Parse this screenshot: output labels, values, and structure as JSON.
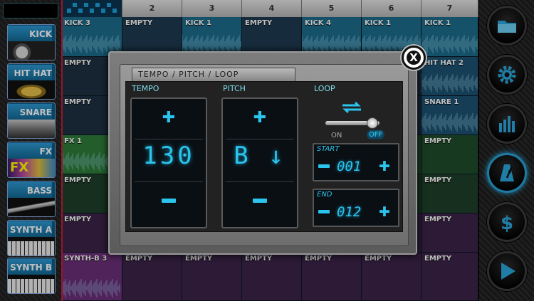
{
  "instruments": [
    "KICK",
    "HIT HAT",
    "SNARE",
    "FX",
    "BASS",
    "SYNTH A",
    "SYNTH B"
  ],
  "columns": [
    "",
    "2",
    "3",
    "4",
    "5",
    "6",
    "7"
  ],
  "rows": [
    [
      "KICK 3",
      "EMPTY",
      "KICK 1",
      "EMPTY",
      "KICK 4",
      "KICK 1",
      "KICK 1"
    ],
    [
      "EMPTY",
      "",
      "",
      "",
      "",
      "",
      "HIT HAT 2"
    ],
    [
      "EMPTY",
      "",
      "",
      "",
      "",
      "",
      "SNARE 1"
    ],
    [
      "FX 1",
      "",
      "",
      "",
      "",
      "",
      "EMPTY"
    ],
    [
      "EMPTY",
      "",
      "",
      "",
      "",
      "",
      "EMPTY"
    ],
    [
      "EMPTY",
      "",
      "",
      "",
      "",
      "",
      "EMPTY"
    ],
    [
      "SYNTH-B 3",
      "EMPTY",
      "EMPTY",
      "EMPTY",
      "EMPTY",
      "EMPTY",
      "EMPTY"
    ]
  ],
  "modal": {
    "title": "TEMPO / PITCH / LOOP",
    "close_label": "X",
    "tempo": {
      "label": "TEMPO",
      "value": "130"
    },
    "pitch": {
      "label": "PITCH",
      "value": "B ↓"
    },
    "loop": {
      "label": "LOOP",
      "on_label": "ON",
      "off_label": "OFF",
      "state": "off",
      "start": {
        "label": "START",
        "value": "001"
      },
      "end": {
        "label": "END",
        "value": "012"
      }
    }
  },
  "colors": {
    "accent": "#2bc4ec",
    "kick": "#1e6f8a",
    "fx": "#2e7a3a",
    "synth": "#6b2f78",
    "playhead": "#c81e3a"
  },
  "right_buttons": [
    "folder-icon",
    "gear-icon",
    "mixer-icon",
    "metronome-icon",
    "dollar-icon",
    "play-icon"
  ]
}
